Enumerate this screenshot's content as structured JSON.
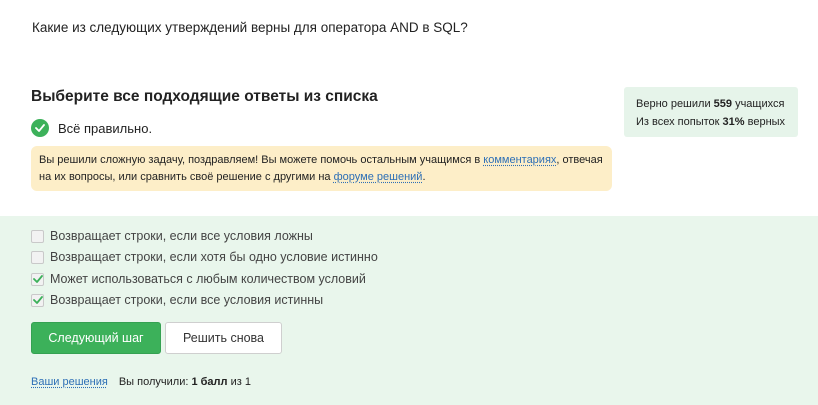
{
  "question": "Какие из следующих утверждений верны для оператора AND в SQL?",
  "choose_title": "Выберите все подходящие ответы из списка",
  "stats": {
    "solved_prefix": "Верно решили",
    "solved_count": "559",
    "solved_suffix": "учащихся",
    "attempts_prefix": "Из всех попыток",
    "attempts_percent": "31%",
    "attempts_suffix": "верных"
  },
  "result": {
    "icon": "check-circle-icon",
    "text": "Всё правильно."
  },
  "notice": {
    "part1": "Вы решили сложную задачу, поздравляем! Вы можете помочь остальным учащимся в",
    "link_comments": "комментариях",
    "part2": ", отвечая на их вопросы, или сравнить своё решение с другими на",
    "link_forum": "форуме решений",
    "part3": "."
  },
  "options": [
    {
      "label": "Возвращает строки, если все условия ложны",
      "checked": false
    },
    {
      "label": "Возвращает строки, если хотя бы одно условие истинно",
      "checked": false
    },
    {
      "label": "Может использоваться с любым количеством условий",
      "checked": true
    },
    {
      "label": "Возвращает строки, если все условия истинны",
      "checked": true
    }
  ],
  "buttons": {
    "next": "Следующий шаг",
    "retry": "Решить снова"
  },
  "footer": {
    "your_solutions": "Ваши решения",
    "score_prefix": "Вы получили:",
    "score_value": "1 балл",
    "score_suffix": "из 1"
  },
  "colors": {
    "accent_green": "#3cb15a",
    "panel_green": "#e9f6ec",
    "notice_yellow": "#fdeec8",
    "link_blue": "#2d6fb6"
  }
}
